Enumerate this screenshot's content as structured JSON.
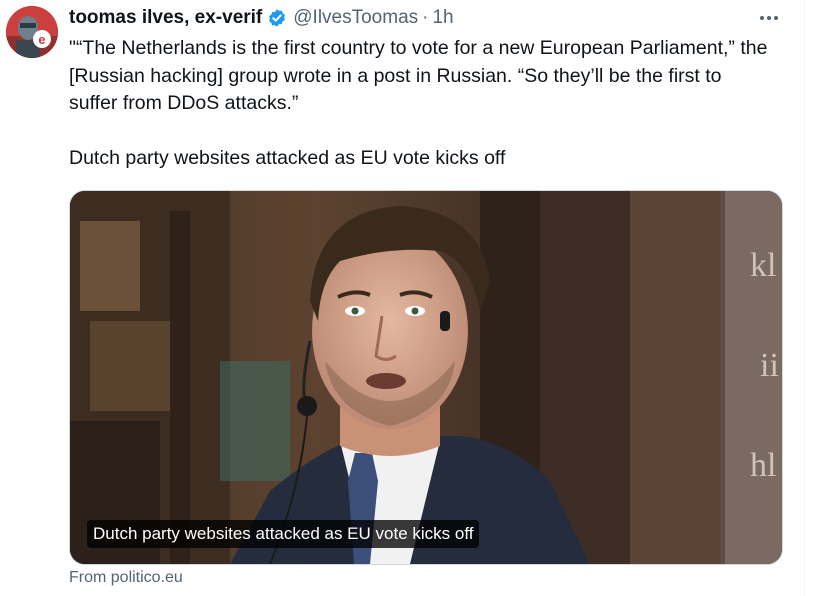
{
  "tweet": {
    "author_name": "toomas ilves, ex-verif",
    "handle": "@IlvesToomas",
    "separator": "·",
    "time": "1h",
    "verified_icon": "verified-badge-icon",
    "more_icon": "more-options-icon",
    "text": "\"“The Netherlands is the first country to vote for a new European Parliament,” the [Russian hacking] group wrote in a post in Russian. “So they’ll be the first to suffer from DDoS attacks.”\n\nDutch party websites attacked as EU vote kicks off",
    "avatar_badge_letter": "e"
  },
  "link_card": {
    "caption": "Dutch party websites attacked as EU vote kicks off",
    "source": "From politico.eu",
    "background_letters": [
      "kl",
      "ii",
      "hl"
    ]
  },
  "colors": {
    "accent_verified": "#1d9bf0",
    "secondary_text": "#536471",
    "primary_text": "#0f1419",
    "avatar_bg": "#d24b4b"
  }
}
